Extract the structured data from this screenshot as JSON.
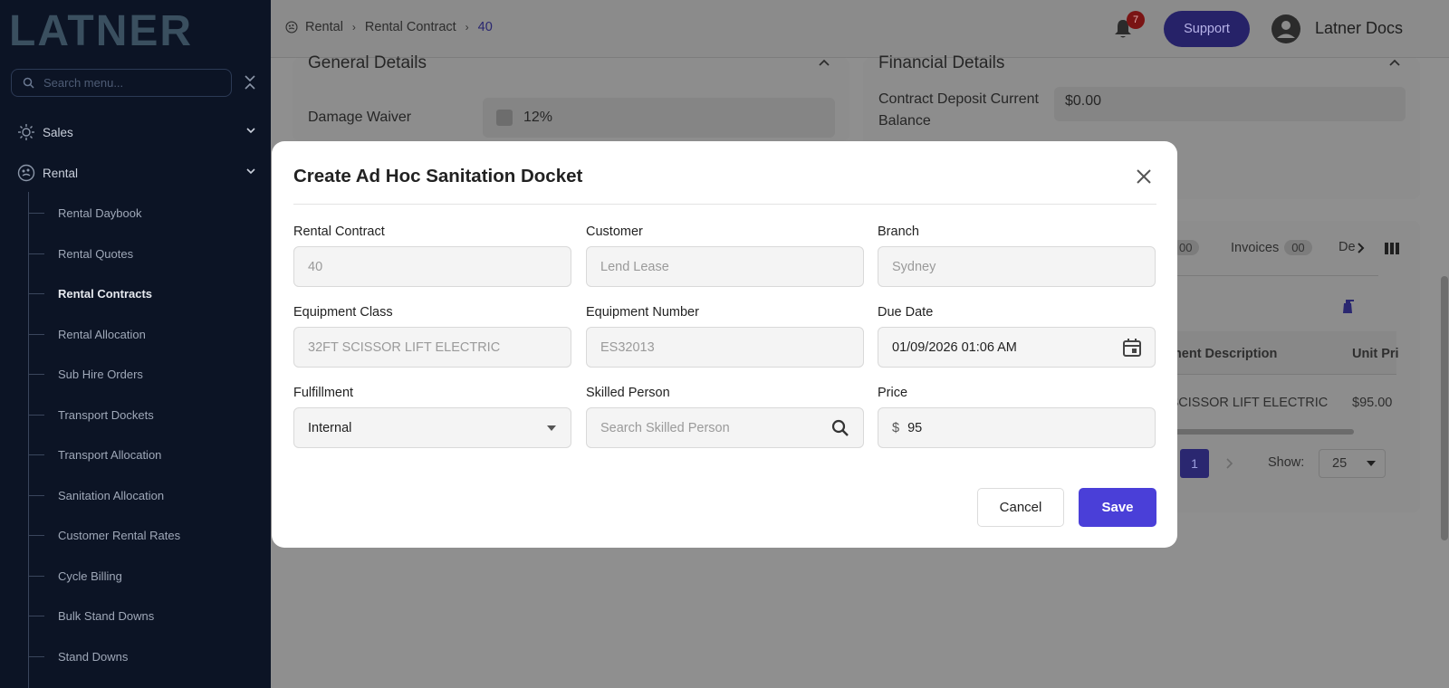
{
  "sidebar": {
    "logo_text": "LATNER",
    "search_placeholder": "Search menu...",
    "menu": [
      {
        "label": "Sales"
      },
      {
        "label": "Rental"
      }
    ],
    "rental_items": [
      {
        "label": "Rental Daybook"
      },
      {
        "label": "Rental Quotes"
      },
      {
        "label": "Rental Contracts"
      },
      {
        "label": "Rental Allocation"
      },
      {
        "label": "Sub Hire Orders"
      },
      {
        "label": "Transport Dockets"
      },
      {
        "label": "Transport Allocation"
      },
      {
        "label": "Sanitation Allocation"
      },
      {
        "label": "Customer Rental Rates"
      },
      {
        "label": "Cycle Billing"
      },
      {
        "label": "Bulk Stand Downs"
      },
      {
        "label": "Stand Downs"
      }
    ]
  },
  "header": {
    "breadcrumb": [
      "Rental",
      "Rental Contract",
      "40"
    ],
    "notification_count": "7",
    "support_label": "Support",
    "user_name": "Latner Docs"
  },
  "background": {
    "general_title": "General Details",
    "damage_waiver_label": "Damage Waiver",
    "damage_waiver_value": "12%",
    "financial_title": "Financial Details",
    "deposit_label_1": "Contract Deposit Current",
    "deposit_label_2": "Balance",
    "deposit_value": "$0.00",
    "tab_count_1": "00",
    "invoices_label": "Invoices",
    "invoices_count": "00",
    "deposits_partial": "De",
    "col_equipment_desc": "ipment Description",
    "col_unit_price": "Unit Pri",
    "row_equipment_desc": "T SCISSOR LIFT ELECTRIC",
    "row_unit_price": "$95.00",
    "page_number": "1",
    "show_label": "Show:",
    "show_value": "25"
  },
  "modal": {
    "title": "Create Ad Hoc Sanitation Docket",
    "fields": {
      "rental_contract": {
        "label": "Rental Contract",
        "value": "40"
      },
      "customer": {
        "label": "Customer",
        "value": "Lend Lease"
      },
      "branch": {
        "label": "Branch",
        "value": "Sydney"
      },
      "equipment_class": {
        "label": "Equipment Class",
        "value": "32FT SCISSOR LIFT ELECTRIC"
      },
      "equipment_number": {
        "label": "Equipment Number",
        "value": "ES32013"
      },
      "due_date": {
        "label": "Due Date",
        "value": "01/09/2026 01:06 AM"
      },
      "fulfillment": {
        "label": "Fulfillment",
        "value": "Internal"
      },
      "skilled_person": {
        "label": "Skilled Person",
        "placeholder": "Search Skilled Person"
      },
      "price": {
        "label": "Price",
        "currency": "$",
        "value": "95"
      }
    },
    "cancel_label": "Cancel",
    "save_label": "Save"
  },
  "colors": {
    "sidebar_bg": "#0c1425",
    "accent": "#4a3fd8",
    "overlay": "#8f8f8f"
  },
  "icons": [
    "logo",
    "search-icon",
    "collapse-icon",
    "sales-icon",
    "rental-icon",
    "chevron-down-icon",
    "bell-icon",
    "user-icon",
    "close-icon",
    "calendar-icon",
    "caret-down-icon",
    "magnifier-icon"
  ]
}
